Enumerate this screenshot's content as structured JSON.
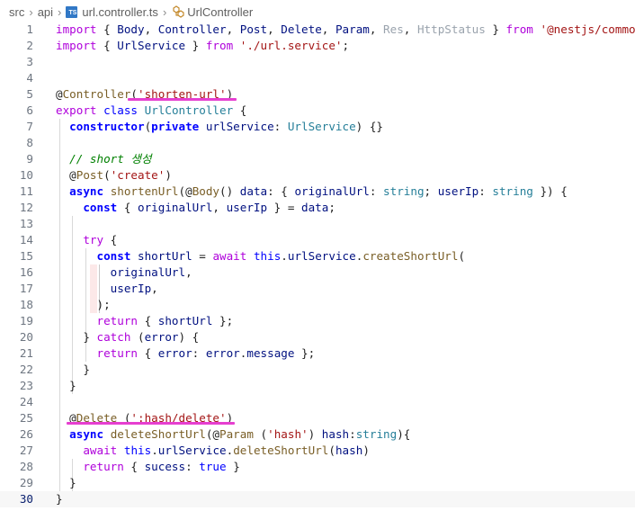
{
  "breadcrumb": {
    "items": [
      "src",
      "api",
      "url.controller.ts",
      "UrlController"
    ],
    "ts_badge": "TS"
  },
  "editor": {
    "current_line": 30,
    "lines": [
      {
        "n": "1",
        "tokens": [
          [
            "import",
            "t-control"
          ],
          [
            " { ",
            "t-plain"
          ],
          [
            "Body",
            "t-ident"
          ],
          [
            ", ",
            "t-plain"
          ],
          [
            "Controller",
            "t-ident"
          ],
          [
            ", ",
            "t-plain"
          ],
          [
            "Post",
            "t-ident"
          ],
          [
            ", ",
            "t-plain"
          ],
          [
            "Delete",
            "t-ident"
          ],
          [
            ", ",
            "t-plain"
          ],
          [
            "Param",
            "t-ident"
          ],
          [
            ", ",
            "t-plain"
          ],
          [
            "Res",
            "t-dim"
          ],
          [
            ", ",
            "t-plain"
          ],
          [
            "HttpStatus",
            "t-dim"
          ],
          [
            " } ",
            "t-plain"
          ],
          [
            "from",
            "t-control"
          ],
          [
            " ",
            "t-plain"
          ],
          [
            "'@nestjs/common'",
            "t-string"
          ],
          [
            ";",
            "t-plain"
          ]
        ]
      },
      {
        "n": "2",
        "tokens": [
          [
            "import",
            "t-control"
          ],
          [
            " { ",
            "t-plain"
          ],
          [
            "UrlService",
            "t-ident"
          ],
          [
            " } ",
            "t-plain"
          ],
          [
            "from",
            "t-control"
          ],
          [
            " ",
            "t-plain"
          ],
          [
            "'./url.service'",
            "t-string"
          ],
          [
            ";",
            "t-plain"
          ]
        ]
      },
      {
        "n": "3",
        "tokens": []
      },
      {
        "n": "4",
        "tokens": []
      },
      {
        "n": "5",
        "tokens": [
          [
            "@",
            "t-plain"
          ],
          [
            "Controller",
            "t-dec"
          ],
          [
            "(",
            "t-plain"
          ],
          [
            "'shorten-url'",
            "t-string"
          ],
          [
            ")",
            "t-plain"
          ]
        ]
      },
      {
        "n": "6",
        "tokens": [
          [
            "export",
            "t-control"
          ],
          [
            " ",
            "t-plain"
          ],
          [
            "class",
            "t-keyword"
          ],
          [
            " ",
            "t-plain"
          ],
          [
            "UrlController",
            "t-type"
          ],
          [
            " {",
            "t-plain"
          ]
        ]
      },
      {
        "n": "7",
        "tokens": [
          [
            "  ",
            "t-plain"
          ],
          [
            "constructor",
            "t-keyword-b"
          ],
          [
            "(",
            "t-plain"
          ],
          [
            "private",
            "t-keyword-b"
          ],
          [
            " ",
            "t-plain"
          ],
          [
            "urlService",
            "t-ident"
          ],
          [
            ": ",
            "t-plain"
          ],
          [
            "UrlService",
            "t-type"
          ],
          [
            ") {}",
            "t-plain"
          ]
        ]
      },
      {
        "n": "8",
        "tokens": []
      },
      {
        "n": "9",
        "tokens": [
          [
            "  ",
            "t-plain"
          ],
          [
            "// short 생성",
            "t-comment"
          ]
        ]
      },
      {
        "n": "10",
        "tokens": [
          [
            "  @",
            "t-plain"
          ],
          [
            "Post",
            "t-dec"
          ],
          [
            "(",
            "t-plain"
          ],
          [
            "'create'",
            "t-string"
          ],
          [
            ")",
            "t-plain"
          ]
        ]
      },
      {
        "n": "11",
        "tokens": [
          [
            "  ",
            "t-plain"
          ],
          [
            "async",
            "t-keyword-b"
          ],
          [
            " ",
            "t-plain"
          ],
          [
            "shortenUrl",
            "t-func"
          ],
          [
            "(@",
            "t-plain"
          ],
          [
            "Body",
            "t-dec"
          ],
          [
            "() ",
            "t-plain"
          ],
          [
            "data",
            "t-ident"
          ],
          [
            ": { ",
            "t-plain"
          ],
          [
            "originalUrl",
            "t-ident"
          ],
          [
            ": ",
            "t-plain"
          ],
          [
            "string",
            "t-type"
          ],
          [
            "; ",
            "t-plain"
          ],
          [
            "userIp",
            "t-ident"
          ],
          [
            ": ",
            "t-plain"
          ],
          [
            "string",
            "t-type"
          ],
          [
            " }) {",
            "t-plain"
          ]
        ]
      },
      {
        "n": "12",
        "tokens": [
          [
            "    ",
            "t-plain"
          ],
          [
            "const",
            "t-keyword-b"
          ],
          [
            " { ",
            "t-plain"
          ],
          [
            "originalUrl",
            "t-ident"
          ],
          [
            ", ",
            "t-plain"
          ],
          [
            "userIp",
            "t-ident"
          ],
          [
            " } = ",
            "t-plain"
          ],
          [
            "data",
            "t-ident"
          ],
          [
            ";",
            "t-plain"
          ]
        ]
      },
      {
        "n": "13",
        "tokens": []
      },
      {
        "n": "14",
        "tokens": [
          [
            "    ",
            "t-plain"
          ],
          [
            "try",
            "t-control"
          ],
          [
            " {",
            "t-plain"
          ]
        ]
      },
      {
        "n": "15",
        "tokens": [
          [
            "      ",
            "t-plain"
          ],
          [
            "const",
            "t-keyword-b"
          ],
          [
            " ",
            "t-plain"
          ],
          [
            "shortUrl",
            "t-ident"
          ],
          [
            " = ",
            "t-plain"
          ],
          [
            "await",
            "t-control"
          ],
          [
            " ",
            "t-plain"
          ],
          [
            "this",
            "t-keyword"
          ],
          [
            ".",
            "t-plain"
          ],
          [
            "urlService",
            "t-ident"
          ],
          [
            ".",
            "t-plain"
          ],
          [
            "createShortUrl",
            "t-func"
          ],
          [
            "(",
            "t-plain"
          ]
        ]
      },
      {
        "n": "16",
        "tokens": [
          [
            "        ",
            "t-plain"
          ],
          [
            "originalUrl",
            "t-ident"
          ],
          [
            ",",
            "t-plain"
          ]
        ]
      },
      {
        "n": "17",
        "tokens": [
          [
            "        ",
            "t-plain"
          ],
          [
            "userIp",
            "t-ident"
          ],
          [
            ",",
            "t-plain"
          ]
        ]
      },
      {
        "n": "18",
        "tokens": [
          [
            "      );",
            "t-plain"
          ]
        ]
      },
      {
        "n": "19",
        "tokens": [
          [
            "      ",
            "t-plain"
          ],
          [
            "return",
            "t-control"
          ],
          [
            " { ",
            "t-plain"
          ],
          [
            "shortUrl",
            "t-ident"
          ],
          [
            " };",
            "t-plain"
          ]
        ]
      },
      {
        "n": "20",
        "tokens": [
          [
            "    } ",
            "t-plain"
          ],
          [
            "catch",
            "t-control"
          ],
          [
            " (",
            "t-plain"
          ],
          [
            "error",
            "t-ident"
          ],
          [
            ") {",
            "t-plain"
          ]
        ]
      },
      {
        "n": "21",
        "tokens": [
          [
            "      ",
            "t-plain"
          ],
          [
            "return",
            "t-control"
          ],
          [
            " { ",
            "t-plain"
          ],
          [
            "error",
            "t-ident"
          ],
          [
            ": ",
            "t-plain"
          ],
          [
            "error",
            "t-ident"
          ],
          [
            ".",
            "t-plain"
          ],
          [
            "message",
            "t-ident"
          ],
          [
            " };",
            "t-plain"
          ]
        ]
      },
      {
        "n": "22",
        "tokens": [
          [
            "    }",
            "t-plain"
          ]
        ]
      },
      {
        "n": "23",
        "tokens": [
          [
            "  }",
            "t-plain"
          ]
        ]
      },
      {
        "n": "24",
        "tokens": []
      },
      {
        "n": "25",
        "tokens": [
          [
            "  @",
            "t-plain"
          ],
          [
            "Delete",
            "t-dec"
          ],
          [
            " (",
            "t-plain"
          ],
          [
            "':hash/delete'",
            "t-string"
          ],
          [
            ")",
            "t-plain"
          ]
        ]
      },
      {
        "n": "26",
        "tokens": [
          [
            "  ",
            "t-plain"
          ],
          [
            "async",
            "t-keyword-b"
          ],
          [
            " ",
            "t-plain"
          ],
          [
            "deleteShortUrl",
            "t-func"
          ],
          [
            "(@",
            "t-plain"
          ],
          [
            "Param",
            "t-dec"
          ],
          [
            " (",
            "t-plain"
          ],
          [
            "'hash'",
            "t-string"
          ],
          [
            ") ",
            "t-plain"
          ],
          [
            "hash",
            "t-ident"
          ],
          [
            ":",
            "t-plain"
          ],
          [
            "string",
            "t-type"
          ],
          [
            "){",
            "t-plain"
          ]
        ]
      },
      {
        "n": "27",
        "tokens": [
          [
            "    ",
            "t-plain"
          ],
          [
            "await",
            "t-control"
          ],
          [
            " ",
            "t-plain"
          ],
          [
            "this",
            "t-keyword"
          ],
          [
            ".",
            "t-plain"
          ],
          [
            "urlService",
            "t-ident"
          ],
          [
            ".",
            "t-plain"
          ],
          [
            "deleteShortUrl",
            "t-func"
          ],
          [
            "(",
            "t-plain"
          ],
          [
            "hash",
            "t-ident"
          ],
          [
            ")",
            "t-plain"
          ]
        ]
      },
      {
        "n": "28",
        "tokens": [
          [
            "    ",
            "t-plain"
          ],
          [
            "return",
            "t-control"
          ],
          [
            " { ",
            "t-plain"
          ],
          [
            "sucess",
            "t-ident"
          ],
          [
            ": ",
            "t-plain"
          ],
          [
            "true",
            "t-keyword"
          ],
          [
            " }",
            "t-plain"
          ]
        ]
      },
      {
        "n": "29",
        "tokens": [
          [
            "  }",
            "t-plain"
          ]
        ]
      },
      {
        "n": "30",
        "tokens": [
          [
            "}",
            "t-plain"
          ]
        ]
      }
    ]
  },
  "colors": {
    "annotation_underline": "#e63fd0",
    "keyword": "#0000ff",
    "control": "#af00db",
    "string": "#a31515",
    "identifier": "#001080",
    "type": "#267f99",
    "function": "#795e26",
    "comment": "#008000"
  }
}
